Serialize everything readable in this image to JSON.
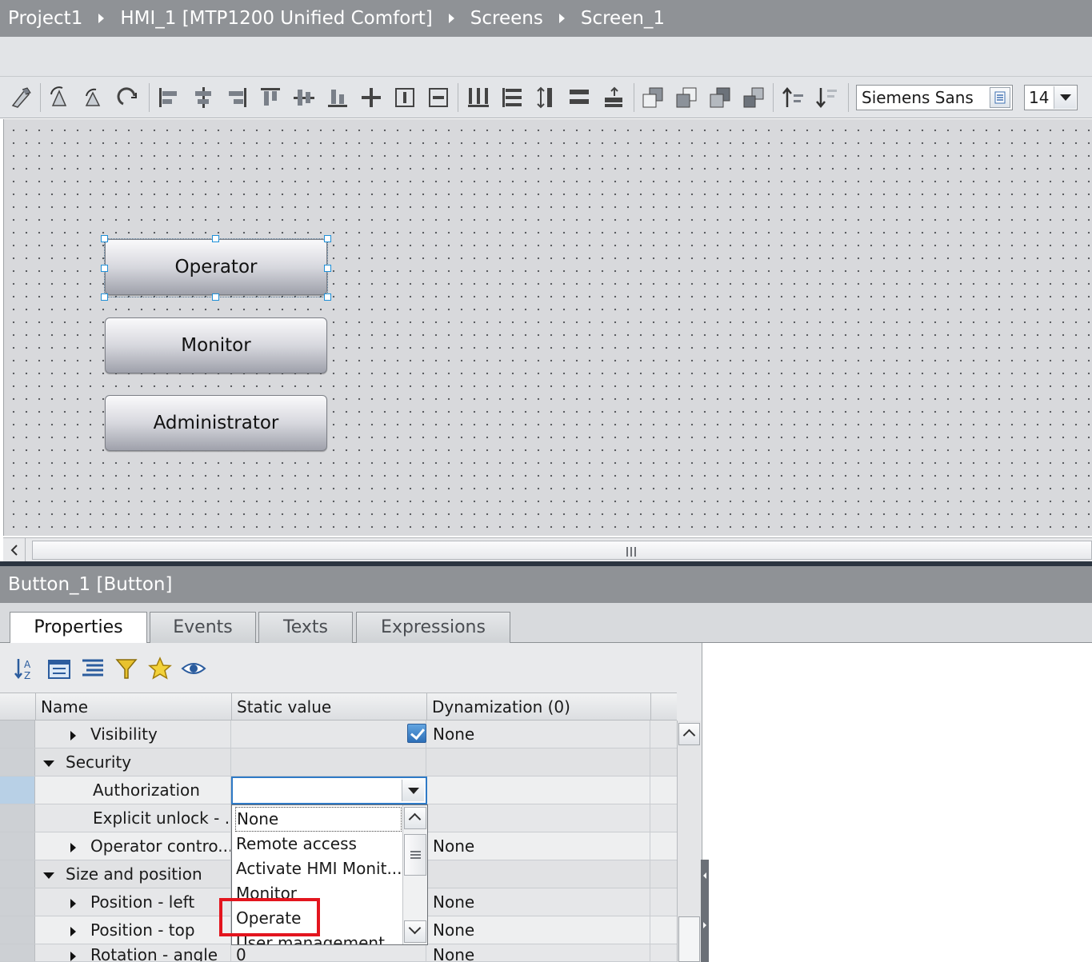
{
  "breadcrumb": [
    "Project1",
    "HMI_1 [MTP1200 Unified Comfort]",
    "Screens",
    "Screen_1"
  ],
  "toolbar": {
    "font_name": "Siemens Sans",
    "font_size": "14",
    "icons": [
      "pointer-icon",
      "rotate-left-icon",
      "undo-icon",
      "redo-icon",
      "align-left-icon",
      "align-center-icon",
      "align-right-icon",
      "align-top-icon",
      "align-middle-icon",
      "align-bottom-icon",
      "center-icon",
      "fit-icon",
      "fit-size-icon",
      "distribute-h-icon",
      "distribute-v-icon",
      "equal-height-icon",
      "equal-width-icon",
      "equal-size-icon",
      "bring-front-icon",
      "bring-forward-icon",
      "send-backward-icon",
      "send-back-icon",
      "sort-up-icon",
      "sort-down-icon"
    ]
  },
  "canvas": {
    "buttons": [
      {
        "label": "Operator",
        "selected": true
      },
      {
        "label": "Monitor",
        "selected": false
      },
      {
        "label": "Administrator",
        "selected": false
      }
    ]
  },
  "inspector": {
    "title": "Button_1 [Button]",
    "tabs": [
      "Properties",
      "Events",
      "Texts",
      "Expressions"
    ],
    "active_tab": "Properties",
    "toolbar_icons": [
      "sort-az-icon",
      "group-icon",
      "list-icon",
      "filter-icon",
      "favorite-icon",
      "eye-icon"
    ],
    "columns": [
      "Name",
      "Static value",
      "Dynamization (0)"
    ],
    "rows": [
      {
        "name": "Visibility",
        "level": 1,
        "expander": "collapsed",
        "static": "",
        "checked": true,
        "dynamization": "None"
      },
      {
        "name": "Security",
        "level": 0,
        "expander": "expanded",
        "static": "",
        "dynamization": ""
      },
      {
        "name": "Authorization",
        "level": 1,
        "expander": "none",
        "static": "",
        "dynamization": ""
      },
      {
        "name": "Explicit unlock - ...",
        "level": 1,
        "expander": "none",
        "static": "",
        "dynamization": ""
      },
      {
        "name": "Operator contro...",
        "level": 1,
        "expander": "collapsed",
        "static": "",
        "dynamization": "None"
      },
      {
        "name": "Size and position",
        "level": 0,
        "expander": "expanded",
        "static": "",
        "dynamization": ""
      },
      {
        "name": "Position - left",
        "level": 1,
        "expander": "collapsed",
        "static": "",
        "dynamization": "None"
      },
      {
        "name": "Position - top",
        "level": 1,
        "expander": "collapsed",
        "static": "",
        "dynamization": "None"
      },
      {
        "name": "Rotation - angle",
        "level": 1,
        "expander": "collapsed",
        "static": "0",
        "dynamization": "None"
      }
    ],
    "authorization_dropdown": {
      "options": [
        "None",
        "Remote access",
        "Activate HMI Monit...",
        "Monitor",
        "Operate",
        "User management"
      ],
      "focused": "None",
      "highlighted": "Operate"
    }
  },
  "colors": {
    "title_bar": "#8f9296",
    "selection_handle": "#1e90d8",
    "highlight_box": "#e3151e",
    "checkbox": "#2d6fb8"
  }
}
